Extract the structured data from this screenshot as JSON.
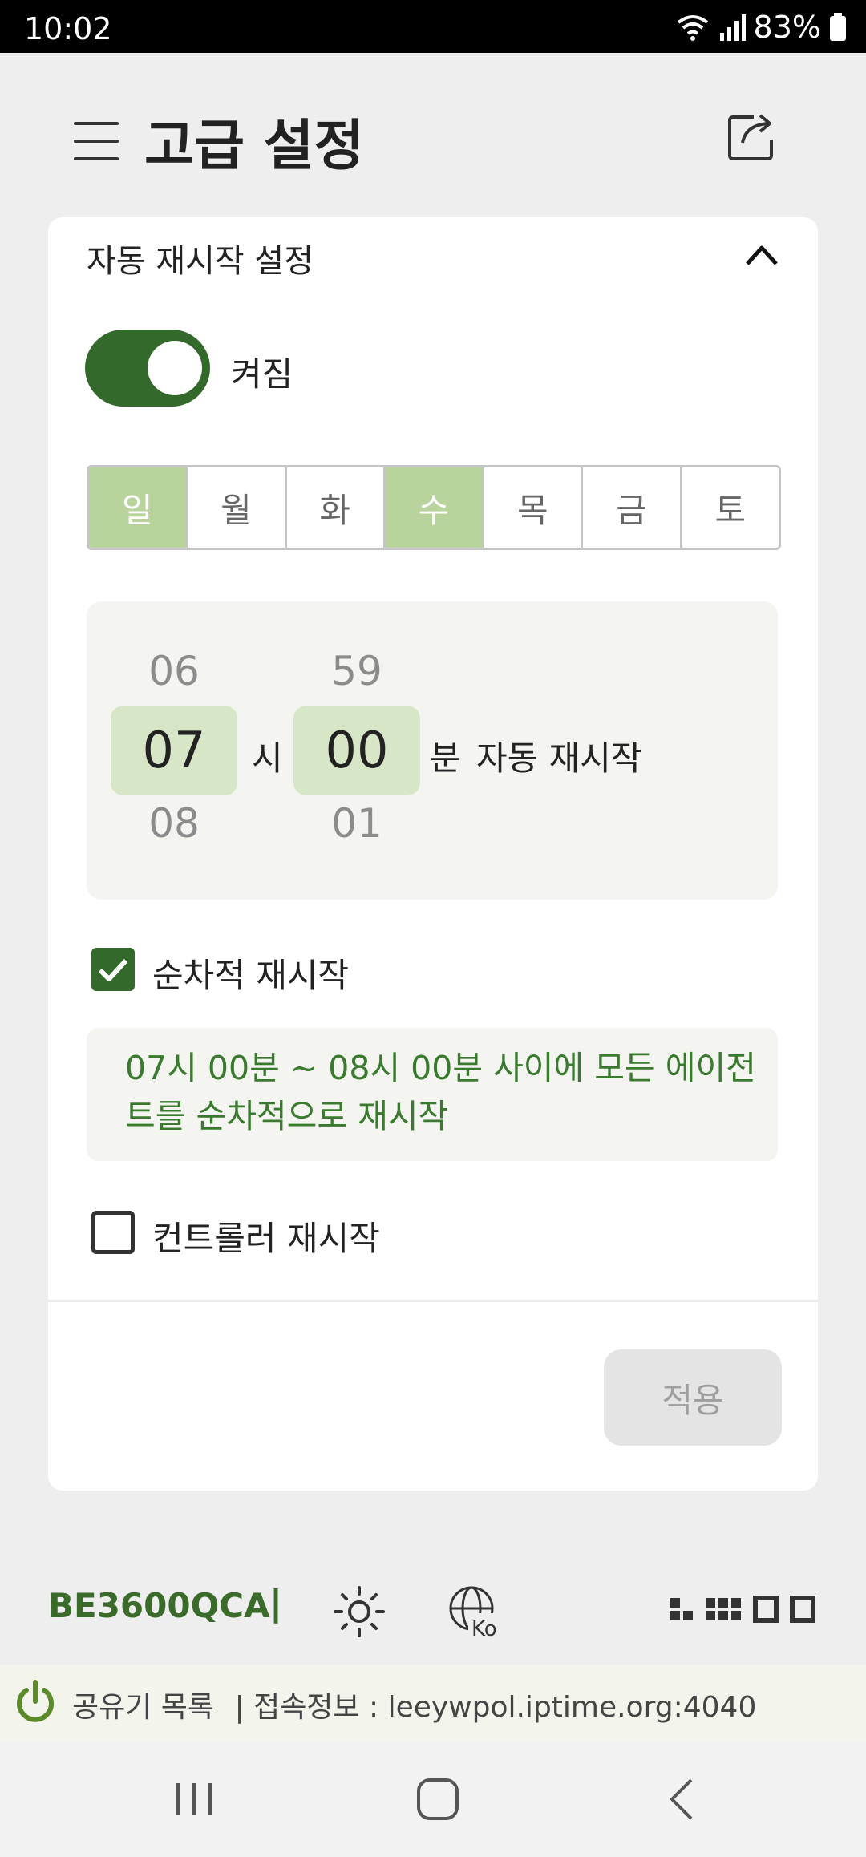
{
  "status_bar": {
    "time": "10:02",
    "battery": "83%"
  },
  "header": {
    "title": "고급 설정",
    "menu_icon": "hamburger-icon",
    "export_icon": "export-icon"
  },
  "auto_restart": {
    "section_title": "자동 재시작 설정",
    "enabled": true,
    "toggle_label": "켜짐",
    "days": [
      {
        "label": "일",
        "selected": true
      },
      {
        "label": "월",
        "selected": false
      },
      {
        "label": "화",
        "selected": false
      },
      {
        "label": "수",
        "selected": true
      },
      {
        "label": "목",
        "selected": false
      },
      {
        "label": "금",
        "selected": false
      },
      {
        "label": "토",
        "selected": false
      }
    ],
    "time_picker": {
      "hour": {
        "prev": "06",
        "current": "07",
        "next": "08"
      },
      "hour_unit": "시",
      "minute": {
        "prev": "59",
        "current": "00",
        "next": "01"
      },
      "minute_unit": "분",
      "suffix": "자동 재시작"
    },
    "sequential_restart": {
      "label": "순차적 재시작",
      "checked": true
    },
    "info_message": "07시 00분 ~ 08시 00분 사이에 모든 에이전트를 순차적으로 재시작",
    "controller_restart": {
      "label": "컨트롤러 재시작",
      "checked": false
    },
    "apply_label": "적용"
  },
  "footer": {
    "model": "BE3600QCA",
    "separator": "|",
    "language_badge": "Ko",
    "router_list_label": "공유기 목록",
    "connection_label": "|  접속정보 : leeywpol.iptime.org:4040"
  },
  "colors": {
    "accent_green": "#33692b",
    "selected_day": "#b9d39c",
    "picker_highlight": "#d6e6c6",
    "info_text": "#3a7a2e"
  }
}
